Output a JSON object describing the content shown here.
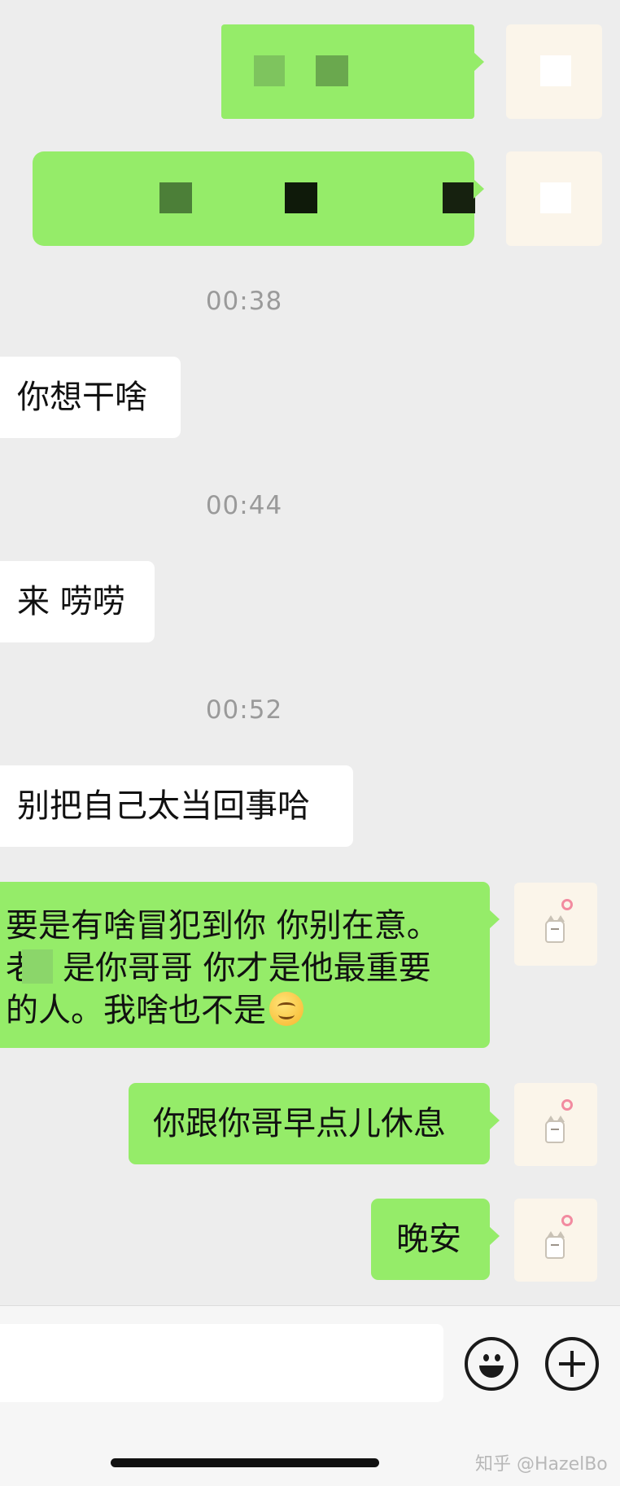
{
  "messages": {
    "timestamp_1": "00:38",
    "msg_1": "你想干啥",
    "timestamp_2": "00:44",
    "msg_2": "来 唠唠",
    "timestamp_3": "00:52",
    "msg_3": "别把自己太当回事哈",
    "msg_4_line1": "要是有啥冒犯到你 你别在意。",
    "msg_4_line2_prefix": "老",
    "msg_4_line2_rest": "是你哥哥 你才是他最重要",
    "msg_4_line3": "的人。我啥也不是",
    "msg_4_emoji": "blush-smile-emoji",
    "msg_5": "你跟你哥早点儿休息",
    "msg_6": "晚安"
  },
  "input_bar": {
    "message_value": "",
    "emoji_icon": "smiley-face-icon",
    "plus_icon": "plus-circle-icon"
  },
  "watermark": "知乎 @HazelBo",
  "colors": {
    "background": "#ededed",
    "outgoing_bubble": "#95ec69",
    "incoming_bubble": "#ffffff",
    "timestamp_text": "#9a9a9a"
  }
}
